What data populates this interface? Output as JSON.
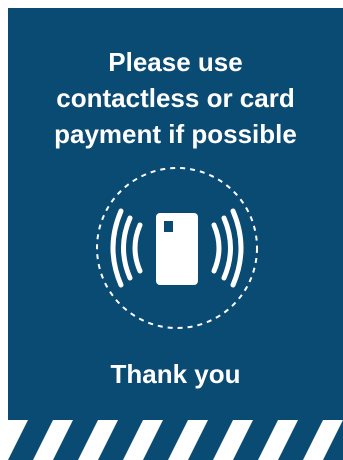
{
  "sign": {
    "headline": "Please use\ncontactless or card\npayment if possible",
    "footer_text": "Thank you",
    "icon": "contactless-card-icon",
    "colors": {
      "background": "#0a4b73",
      "foreground": "#ffffff"
    }
  }
}
